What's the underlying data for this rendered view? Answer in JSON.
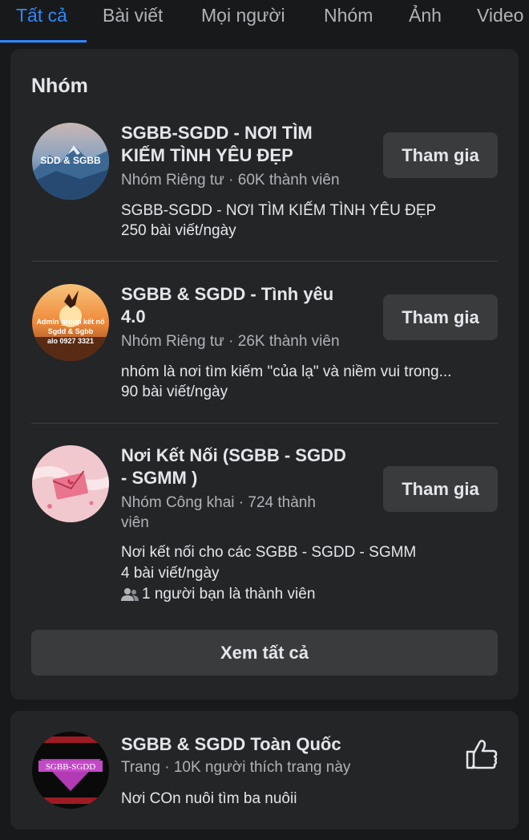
{
  "tabs": [
    {
      "label": "Tất cả"
    },
    {
      "label": "Bài viết"
    },
    {
      "label": "Mọi người"
    },
    {
      "label": "Nhóm"
    },
    {
      "label": "Ảnh"
    },
    {
      "label": "Video"
    }
  ],
  "groups_section": {
    "title": "Nhóm",
    "see_all_label": "Xem tất cả",
    "items": [
      {
        "name_line1": "SGBB-SGDD - NƠI TÌM",
        "name_line2": "KIẾM TÌNH YÊU ĐẸP",
        "meta": "Nhóm Riêng tư · 60K thành viên",
        "description": "SGBB-SGDD - NƠI TÌM KIẾM TÌNH YÊU ĐẸP",
        "posts": "250 bài viết/ngày",
        "join_label": "Tham gia",
        "avatar_text": "SDD & SGBB",
        "avatar_icon": "mountain-avatar"
      },
      {
        "name_line1": "SGBB & SGDD - Tình yêu",
        "name_line2": "4.0",
        "meta": "Nhóm Riêng tư · 26K thành viên",
        "description": "nhóm là nơi tìm kiếm \"của lạ\" và niềm vui trong...",
        "posts": "90 bài viết/ngày",
        "join_label": "Tham gia",
        "avatar_line1": "Admin group kết nố",
        "avatar_line2": "Sgdd & Sgbb",
        "avatar_line3": "alo 0927 3321",
        "avatar_icon": "sunset-avatar"
      },
      {
        "name_line1": "Nơi Kết Nối (SGBB - SGDD",
        "name_line2": "- SGMM )",
        "meta_line1": "Nhóm Công khai · 724 thành",
        "meta_line2": "viên",
        "description": "Nơi kết nối cho các SGBB - SGDD - SGMM",
        "posts": "4 bài viết/ngày",
        "friends": "1 người bạn là thành viên",
        "join_label": "Tham gia",
        "avatar_icon": "envelope-hands-avatar"
      }
    ]
  },
  "page_result": {
    "name": "SGBB & SGDD Toàn Quốc",
    "meta": "Trang · 10K người thích trang này",
    "description": "Nơi COn nuôi tìm ba nuôii",
    "avatar_text": "SGBB-SGDD",
    "like_icon": "thumbs-up-icon"
  },
  "colors": {
    "background": "#18191a",
    "card": "#242526",
    "button": "#3a3b3c",
    "accent": "#2d88ff",
    "secondary_text": "#b0b3b8"
  }
}
